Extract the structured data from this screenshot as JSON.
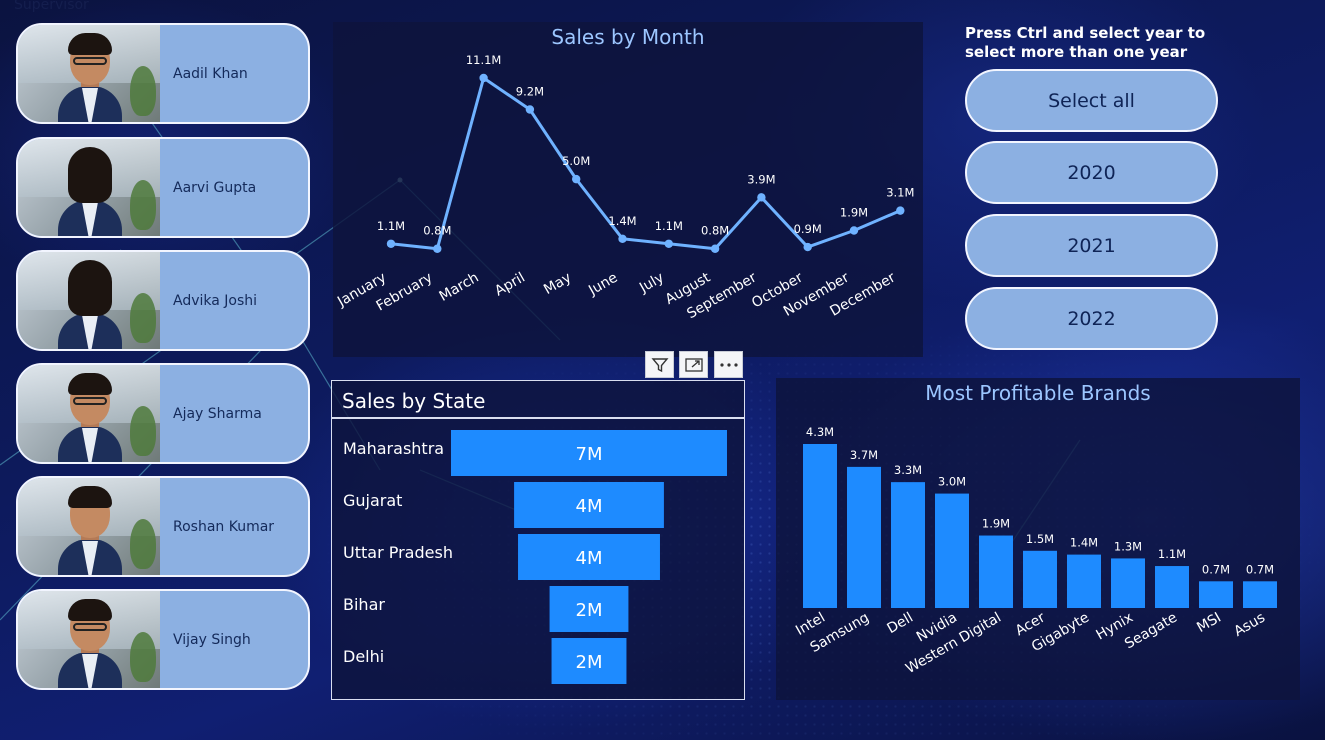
{
  "header": {
    "corner_label": "Supervisor"
  },
  "supervisors": [
    {
      "name": "Aadil Khan",
      "photo_icon": "portrait-photo"
    },
    {
      "name": "Aarvi Gupta",
      "photo_icon": "portrait-photo"
    },
    {
      "name": "Advika Joshi",
      "photo_icon": "portrait-photo"
    },
    {
      "name": "Ajay Sharma",
      "photo_icon": "portrait-photo"
    },
    {
      "name": "Roshan Kumar",
      "photo_icon": "portrait-photo"
    },
    {
      "name": "Vijay Singh",
      "photo_icon": "portrait-photo"
    }
  ],
  "year_slicer": {
    "hint": "Press Ctrl and select year to select more than one year",
    "options": [
      "Select all",
      "2020",
      "2021",
      "2022"
    ]
  },
  "visual_header_icons": [
    "filter-icon",
    "focus-mode-icon",
    "more-options-icon"
  ],
  "colors": {
    "bar": "#1e8bff",
    "line": "#6fb2ff",
    "title": "#9cc6ff",
    "card": "#8cb0e2"
  },
  "chart_data": [
    {
      "type": "line",
      "title": "Sales by Month",
      "categories": [
        "January",
        "February",
        "March",
        "April",
        "May",
        "June",
        "July",
        "August",
        "September",
        "October",
        "November",
        "December"
      ],
      "values": [
        1.1,
        0.8,
        11.1,
        9.2,
        5.0,
        1.4,
        1.1,
        0.8,
        3.9,
        0.9,
        1.9,
        3.1
      ],
      "data_labels": [
        "1.1M",
        "0.8M",
        "11.1M",
        "9.2M",
        "5.0M",
        "1.4M",
        "1.1M",
        "0.8M",
        "3.9M",
        "0.9M",
        "1.9M",
        "3.1M"
      ],
      "ylim": [
        0,
        11.1
      ]
    },
    {
      "type": "bar",
      "orientation": "horizontal",
      "style": "funnel",
      "title": "Sales by State",
      "categories": [
        "Maharashtra",
        "Gujarat",
        "Uttar Pradesh",
        "Bihar",
        "Delhi"
      ],
      "values": [
        7,
        3.8,
        3.6,
        2.0,
        1.9
      ],
      "data_labels": [
        "7M",
        "4M",
        "4M",
        "2M",
        "2M"
      ]
    },
    {
      "type": "bar",
      "title": "Most Profitable Brands",
      "categories": [
        "Intel",
        "Samsung",
        "Dell",
        "Nvidia",
        "Western Digital",
        "Acer",
        "Gigabyte",
        "Hynix",
        "Seagate",
        "MSI",
        "Asus"
      ],
      "values": [
        4.3,
        3.7,
        3.3,
        3.0,
        1.9,
        1.5,
        1.4,
        1.3,
        1.1,
        0.7,
        0.7
      ],
      "data_labels": [
        "4.3M",
        "3.7M",
        "3.3M",
        "3.0M",
        "1.9M",
        "1.5M",
        "1.4M",
        "1.3M",
        "1.1M",
        "0.7M",
        "0.7M"
      ],
      "ylim": [
        0,
        4.3
      ]
    }
  ]
}
